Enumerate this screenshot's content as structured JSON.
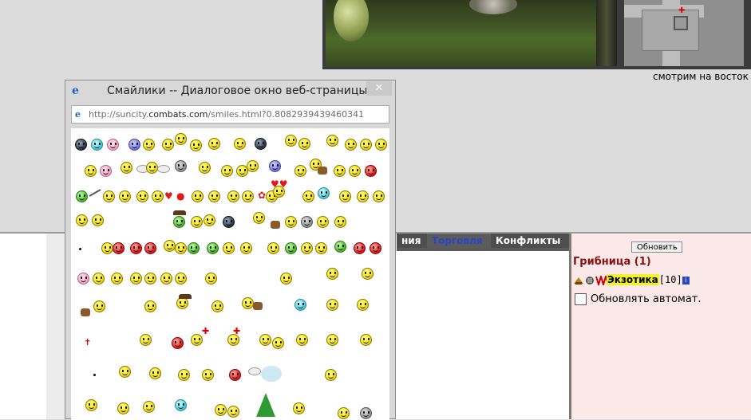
{
  "game": {
    "direction_text": "смотрим на восток"
  },
  "tabs": [
    {
      "label": "ния"
    },
    {
      "label": "Торговля"
    },
    {
      "label": "Конфликты"
    }
  ],
  "right_panel": {
    "refresh_label": "Обновить",
    "location": "Грибница (1)",
    "player": {
      "name": "Экзотика",
      "level": "[10]",
      "info": "i"
    },
    "auto_refresh_label": "Обновлять автомат."
  },
  "dialog": {
    "title": "Смайлики -- Диалоговое окно веб-страницы",
    "close": "✕",
    "address": {
      "prefix": "http://suncity.",
      "domain": "combats.com",
      "suffix": "/smiles.html?0.8082939439460341"
    }
  },
  "colors": {
    "accent_link": "#2b43c9",
    "location_red": "#8b1010",
    "name_highlight": "#f2f229",
    "panel_pink": "#fbe8e8"
  },
  "icons": {
    "ie_page": "ie-page-icon",
    "close": "close-icon",
    "info": "info-icon",
    "smiley": "smiley-icon"
  }
}
